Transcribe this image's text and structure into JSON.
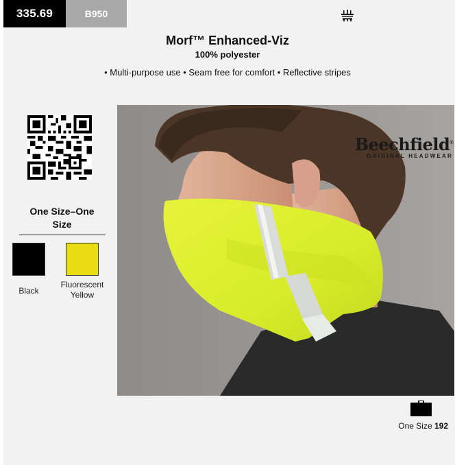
{
  "header": {
    "code": "335.69",
    "sku": "B950",
    "logo_icon": "crown-logo-icon"
  },
  "product": {
    "title": "Morf™ Enhanced-Viz",
    "material": "100% polyester",
    "features": "• Multi-purpose use • Seam free for comfort • Reflective stripes"
  },
  "qr_icon": "qr-code-icon",
  "sizes": {
    "title": "One Size–One Size"
  },
  "colors": [
    {
      "label": "Black",
      "hex": "#000000"
    },
    {
      "label": "Fluorescent Yellow",
      "hex": "#eadc12"
    }
  ],
  "photo": {
    "brand_name": "Beechfield",
    "brand_sub": "ORIGINAL HEADWEAR",
    "brand_mark": "®"
  },
  "footer": {
    "icon": "bag-icon",
    "size_label": "One Size",
    "size_number": "192"
  }
}
